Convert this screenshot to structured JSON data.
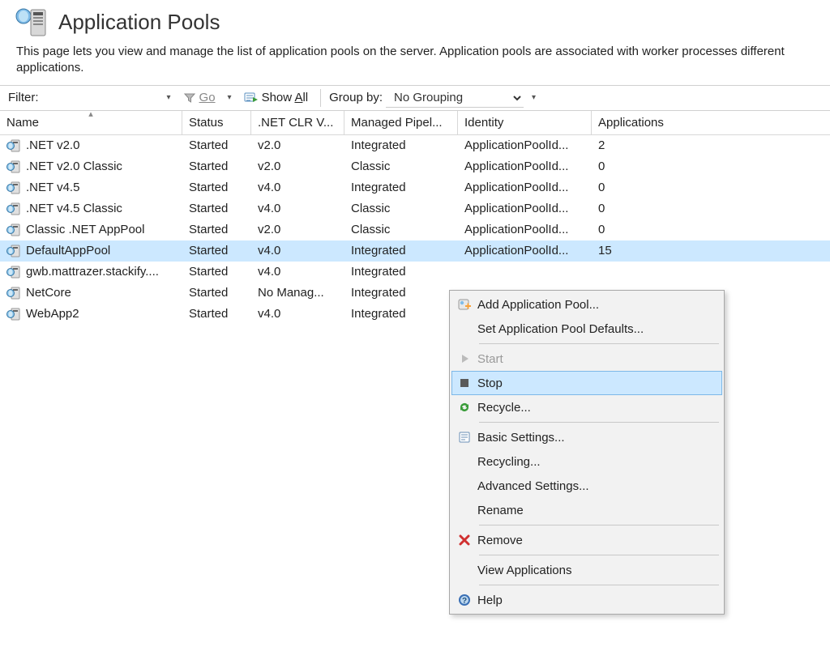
{
  "header": {
    "title": "Application Pools"
  },
  "description": "This page lets you view and manage the list of application pools on the server. Application pools are associated with worker processes different applications.",
  "toolbar": {
    "filter_label": "Filter:",
    "filter_value": "",
    "go_label": "Go",
    "show_all_label": "Show All",
    "group_by_label": "Group by:",
    "group_by_value": "No Grouping"
  },
  "columns": {
    "name": "Name",
    "status": "Status",
    "clr": ".NET CLR V...",
    "pipeline": "Managed Pipel...",
    "identity": "Identity",
    "applications": "Applications"
  },
  "rows": [
    {
      "name": ".NET v2.0",
      "status": "Started",
      "clr": "v2.0",
      "pipeline": "Integrated",
      "identity": "ApplicationPoolId...",
      "apps": "2",
      "selected": false
    },
    {
      "name": ".NET v2.0 Classic",
      "status": "Started",
      "clr": "v2.0",
      "pipeline": "Classic",
      "identity": "ApplicationPoolId...",
      "apps": "0",
      "selected": false
    },
    {
      "name": ".NET v4.5",
      "status": "Started",
      "clr": "v4.0",
      "pipeline": "Integrated",
      "identity": "ApplicationPoolId...",
      "apps": "0",
      "selected": false
    },
    {
      "name": ".NET v4.5 Classic",
      "status": "Started",
      "clr": "v4.0",
      "pipeline": "Classic",
      "identity": "ApplicationPoolId...",
      "apps": "0",
      "selected": false
    },
    {
      "name": "Classic .NET AppPool",
      "status": "Started",
      "clr": "v2.0",
      "pipeline": "Classic",
      "identity": "ApplicationPoolId...",
      "apps": "0",
      "selected": false
    },
    {
      "name": "DefaultAppPool",
      "status": "Started",
      "clr": "v4.0",
      "pipeline": "Integrated",
      "identity": "ApplicationPoolId...",
      "apps": "15",
      "selected": true
    },
    {
      "name": "gwb.mattrazer.stackify....",
      "status": "Started",
      "clr": "v4.0",
      "pipeline": "Integrated",
      "identity": "",
      "apps": "",
      "selected": false
    },
    {
      "name": "NetCore",
      "status": "Started",
      "clr": "No Manag...",
      "pipeline": "Integrated",
      "identity": "",
      "apps": "",
      "selected": false
    },
    {
      "name": "WebApp2",
      "status": "Started",
      "clr": "v4.0",
      "pipeline": "Integrated",
      "identity": "",
      "apps": "",
      "selected": false
    }
  ],
  "context_menu": {
    "add": "Add Application Pool...",
    "defaults": "Set Application Pool Defaults...",
    "start": "Start",
    "stop": "Stop",
    "recycle": "Recycle...",
    "basic": "Basic Settings...",
    "recycling": "Recycling...",
    "advanced": "Advanced Settings...",
    "rename": "Rename",
    "remove": "Remove",
    "viewapps": "View Applications",
    "help": "Help"
  }
}
